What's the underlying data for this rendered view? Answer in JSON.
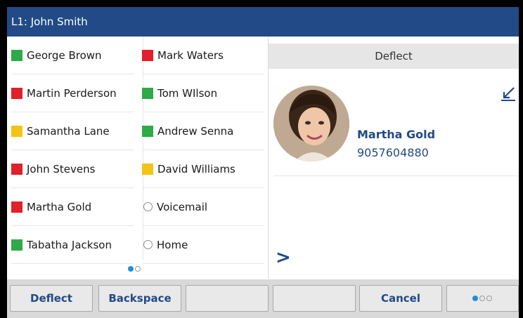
{
  "header": {
    "title": "L1: John Smith"
  },
  "contacts": {
    "left": [
      {
        "name": "George Brown",
        "status": "green"
      },
      {
        "name": "Martin Perderson",
        "status": "red"
      },
      {
        "name": "Samantha Lane",
        "status": "yellow"
      },
      {
        "name": "John Stevens",
        "status": "red"
      },
      {
        "name": "Martha Gold",
        "status": "red"
      },
      {
        "name": "Tabatha Jackson",
        "status": "green"
      }
    ],
    "right": [
      {
        "name": "Mark Waters",
        "status": "red"
      },
      {
        "name": "Tom WIlson",
        "status": "green"
      },
      {
        "name": "Andrew Senna",
        "status": "green"
      },
      {
        "name": "David Williams",
        "status": "yellow"
      },
      {
        "name": "Voicemail",
        "status": "none"
      },
      {
        "name": "Home",
        "status": "none"
      }
    ],
    "page": {
      "current": 1,
      "total": 2
    }
  },
  "call": {
    "action_bar": "Deflect",
    "caller_name": "Martha Gold",
    "caller_number": "9057604880",
    "more_symbol": ">"
  },
  "softkeys": {
    "keys": [
      "Deflect",
      "Backspace",
      "",
      "",
      "Cancel"
    ],
    "page": {
      "current": 1,
      "total": 3
    }
  },
  "colors": {
    "header": "#214a87",
    "green": "#2eaa48",
    "red": "#e0202a",
    "yellow": "#f3c316",
    "dot_on": "#1e8fd6"
  }
}
